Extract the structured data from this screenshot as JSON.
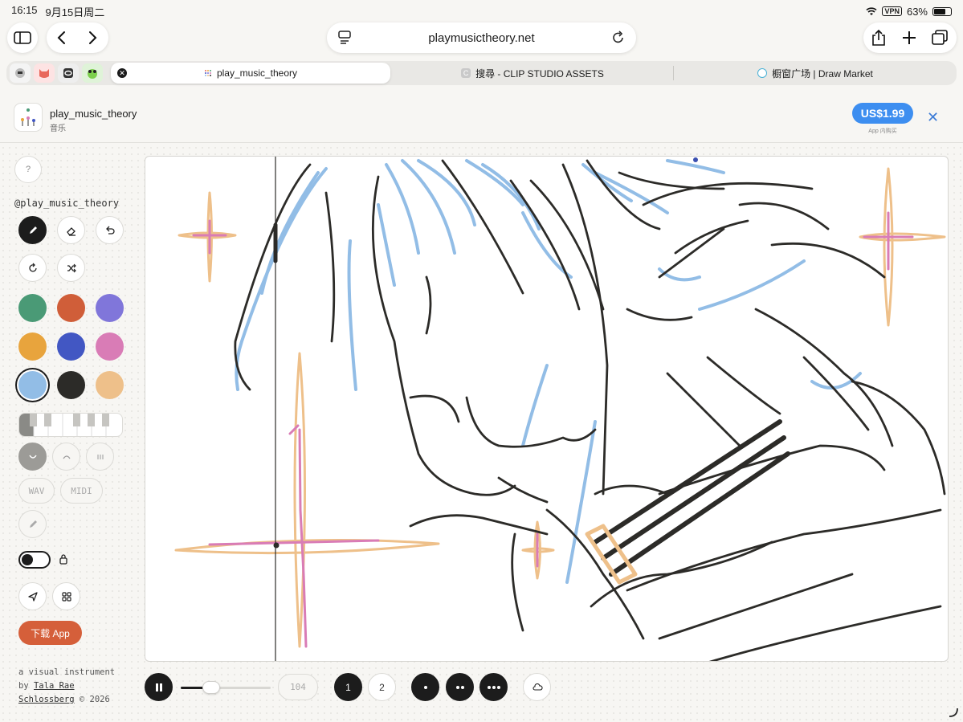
{
  "status": {
    "time": "16:15",
    "date": "9月15日周二",
    "vpn": "VPN",
    "battery": "63%"
  },
  "browser": {
    "url": "playmusictheory.net",
    "tabs": [
      {
        "title": "play_music_theory",
        "active": true
      },
      {
        "title": "搜尋 - CLIP STUDIO ASSETS",
        "favicon_letter": "C"
      },
      {
        "title": "橱窗广场 | Draw Market"
      }
    ]
  },
  "banner": {
    "app_name": "play_music_theory",
    "category": "音乐",
    "price": "US$1.99",
    "price_sub": "App 内购买"
  },
  "sidebar": {
    "help": "?",
    "handle": "@play_music_theory",
    "colors": [
      "#4a9a76",
      "#d05e39",
      "#8076da",
      "#e8a43d",
      "#4257c3",
      "#d97cb6",
      "#92bde6",
      "#2c2b28",
      "#eec08a"
    ],
    "selected_color": "#92bde6",
    "export_wav": "WAV",
    "export_midi": "MIDI",
    "download": "下载 App",
    "credit_line1": "a visual instrument",
    "credit_by": "by",
    "credit_author1": "Tala Rae",
    "credit_author2": "Schlossberg",
    "credit_year": "© 2026"
  },
  "controls": {
    "tempo": "104",
    "tempo_fill": 0.34,
    "track1": "1",
    "track2": "2"
  }
}
